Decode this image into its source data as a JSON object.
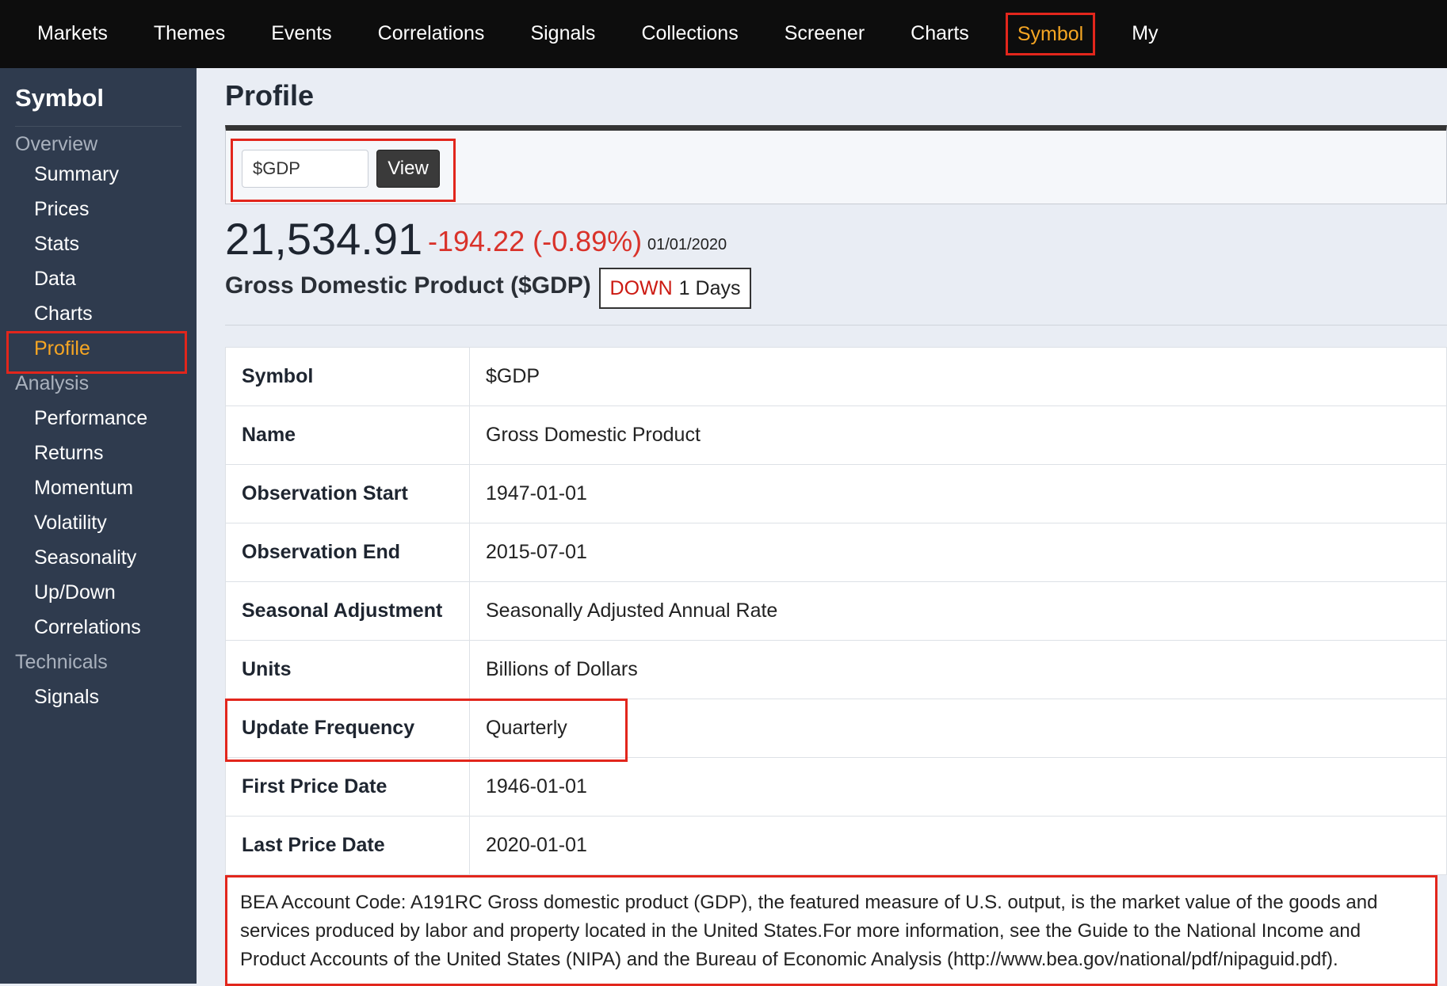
{
  "topnav": {
    "items": [
      "Markets",
      "Themes",
      "Events",
      "Correlations",
      "Signals",
      "Collections",
      "Screener",
      "Charts",
      "Symbol",
      "My"
    ],
    "active": "Symbol"
  },
  "sidebar": {
    "title": "Symbol",
    "groups": {
      "overview": "Overview",
      "analysis": "Analysis",
      "technicals": "Technicals"
    },
    "items": {
      "summary": "Summary",
      "prices": "Prices",
      "stats": "Stats",
      "data": "Data",
      "charts": "Charts",
      "profile": "Profile",
      "performance": "Performance",
      "returns": "Returns",
      "momentum": "Momentum",
      "volatility": "Volatility",
      "seasonality": "Seasonality",
      "updown": "Up/Down",
      "correlations": "Correlations",
      "signals": "Signals"
    },
    "active": "Profile"
  },
  "page": {
    "title": "Profile",
    "search": {
      "value": "$GDP",
      "button": "View"
    },
    "quote": {
      "price": "21,534.91",
      "change": "-194.22 (-0.89%)",
      "date": "01/01/2020"
    },
    "full_name": "Gross Domestic Product ($GDP)",
    "trend": {
      "direction": "DOWN",
      "text": "1 Days"
    }
  },
  "profile_table": {
    "rows": [
      {
        "key": "Symbol",
        "value": "$GDP"
      },
      {
        "key": "Name",
        "value": "Gross Domestic Product"
      },
      {
        "key": "Observation Start",
        "value": "1947-01-01"
      },
      {
        "key": "Observation End",
        "value": "2015-07-01"
      },
      {
        "key": "Seasonal Adjustment",
        "value": "Seasonally Adjusted Annual Rate"
      },
      {
        "key": "Units",
        "value": "Billions of Dollars"
      },
      {
        "key": "Update Frequency",
        "value": "Quarterly"
      },
      {
        "key": "First Price Date",
        "value": "1946-01-01"
      },
      {
        "key": "Last Price Date",
        "value": "2020-01-01"
      }
    ],
    "description": "BEA Account Code: A191RC Gross domestic product (GDP), the featured measure of U.S. output, is the market value of the goods and services produced by labor and property located in the United States.For more information, see the Guide to the National Income and Product Accounts of the United States (NIPA) and the Bureau of Economic Analysis (http://www.bea.gov/national/pdf/nipaguid.pdf)."
  },
  "colors": {
    "accent": "#f6a623",
    "highlight": "#e2261c",
    "negative": "#d9322a",
    "sidebar_bg": "#2f3b4e",
    "topnav_bg": "#0d0d0d"
  }
}
